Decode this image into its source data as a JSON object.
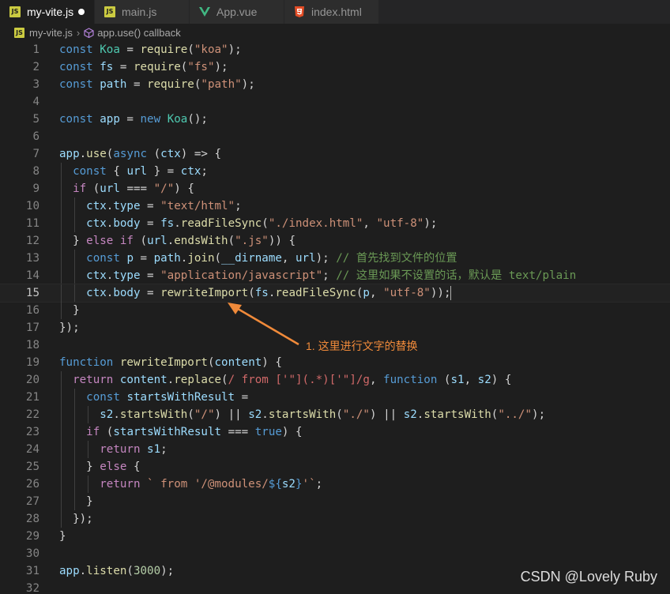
{
  "tabs": [
    {
      "label": "my-vite.js",
      "icon": "js-file-icon",
      "active": true,
      "modified": true
    },
    {
      "label": "main.js",
      "icon": "js-file-icon",
      "active": false
    },
    {
      "label": "App.vue",
      "icon": "vue-file-icon",
      "active": false
    },
    {
      "label": "index.html",
      "icon": "html5-file-icon",
      "active": false
    }
  ],
  "breadcrumb": {
    "file": "my-vite.js",
    "symbol": "app.use() callback"
  },
  "editor": {
    "current_line": 15,
    "line_numbers": [
      "1",
      "2",
      "3",
      "4",
      "5",
      "6",
      "7",
      "8",
      "9",
      "10",
      "11",
      "12",
      "13",
      "14",
      "15",
      "16",
      "17",
      "18",
      "19",
      "20",
      "21",
      "22",
      "23",
      "24",
      "25",
      "26",
      "27",
      "28",
      "29",
      "30",
      "31",
      "32"
    ]
  },
  "annotation": {
    "text": "1. 这里进行文字的替换",
    "color": "#f08a3a"
  },
  "watermark": "CSDN @Lovely Ruby",
  "colors": {
    "keyword": "#569cd6",
    "control": "#c586c0",
    "variable": "#9cdcfe",
    "class": "#4ec9b0",
    "function": "#dcdcaa",
    "string": "#ce9178",
    "number": "#b5cea8",
    "comment": "#6a9955"
  },
  "code_lines": [
    "const Koa = require(\"koa\");",
    "const fs = require(\"fs\");",
    "const path = require(\"path\");",
    "",
    "const app = new Koa();",
    "",
    "app.use(async (ctx) => {",
    "  const { url } = ctx;",
    "  if (url === \"/\") {",
    "    ctx.type = \"text/html\";",
    "    ctx.body = fs.readFileSync(\"./index.html\", \"utf-8\");",
    "  } else if (url.endsWith(\".js\")) {",
    "    const p = path.join(__dirname, url); // 首先找到文件的位置",
    "    ctx.type = \"application/javascript\"; // 这里如果不设置的话，默认是 text/plain",
    "    ctx.body = rewriteImport(fs.readFileSync(p, \"utf-8\"));",
    "  }",
    "});",
    "",
    "function rewriteImport(content) {",
    "  return content.replace(/ from ['\"](.*)['\"]/g, function (s1, s2) {",
    "    const startsWithResult =",
    "      s2.startsWith(\"/\") || s2.startsWith(\"./\") || s2.startsWith(\"../\");",
    "    if (startsWithResult === true) {",
    "      return s1;",
    "    } else {",
    "      return ` from '/@modules/${s2}'`;",
    "    }",
    "  });",
    "}",
    "",
    "app.listen(3000);",
    ""
  ]
}
